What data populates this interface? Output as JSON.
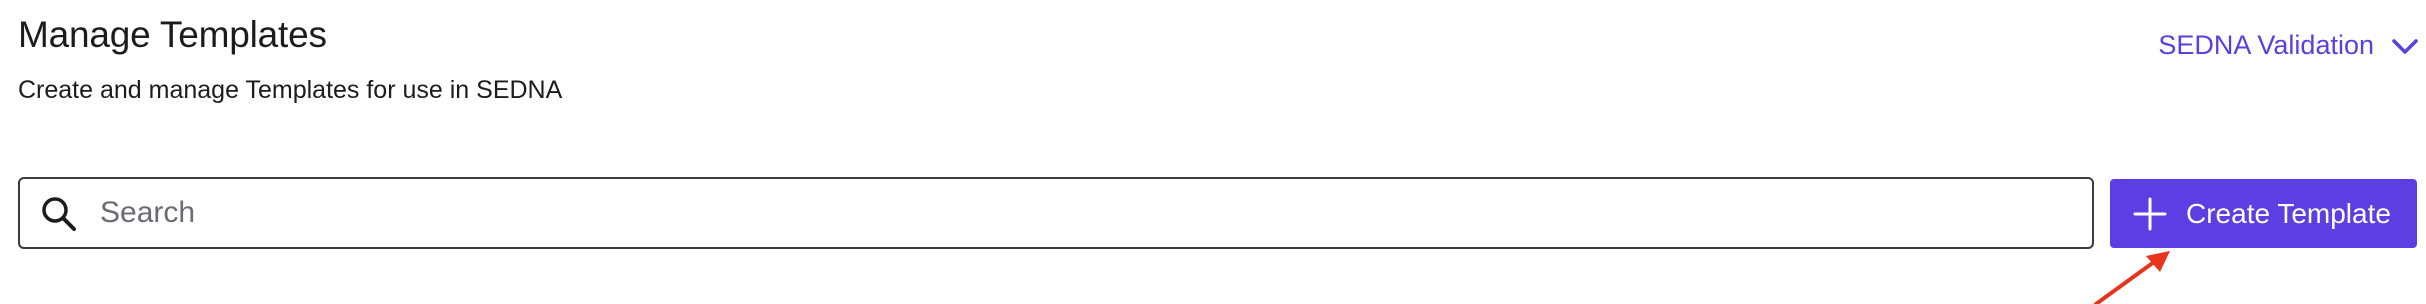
{
  "header": {
    "title": "Manage Templates",
    "subtitle": "Create and manage Templates for use in SEDNA"
  },
  "workspace_switcher": {
    "label": "SEDNA Validation",
    "icon": "chevron-down-icon",
    "color": "#5b3fe0"
  },
  "search": {
    "placeholder": "Search",
    "value": "",
    "icon": "search-icon"
  },
  "actions": {
    "create_template_label": "Create Template",
    "create_template_icon": "plus-icon",
    "accent": "#5b3fe3"
  },
  "annotation": {
    "icon": "arrow-icon",
    "color": "#e8341c"
  }
}
